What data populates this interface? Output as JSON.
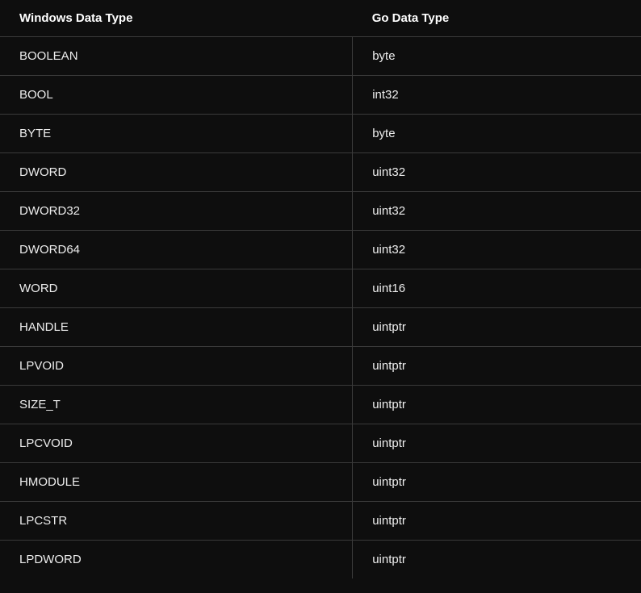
{
  "table": {
    "headers": {
      "col1": "Windows Data Type",
      "col2": "Go Data Type"
    },
    "rows": [
      {
        "windows": "BOOLEAN",
        "go": "byte"
      },
      {
        "windows": "BOOL",
        "go": "int32"
      },
      {
        "windows": "BYTE",
        "go": "byte"
      },
      {
        "windows": "DWORD",
        "go": "uint32"
      },
      {
        "windows": "DWORD32",
        "go": "uint32"
      },
      {
        "windows": "DWORD64",
        "go": "uint32"
      },
      {
        "windows": "WORD",
        "go": "uint16"
      },
      {
        "windows": "HANDLE",
        "go": "uintptr"
      },
      {
        "windows": "LPVOID",
        "go": "uintptr"
      },
      {
        "windows": "SIZE_T",
        "go": "uintptr"
      },
      {
        "windows": "LPCVOID",
        "go": "uintptr"
      },
      {
        "windows": "HMODULE",
        "go": "uintptr"
      },
      {
        "windows": "LPCSTR",
        "go": "uintptr"
      },
      {
        "windows": "LPDWORD",
        "go": "uintptr"
      }
    ]
  }
}
